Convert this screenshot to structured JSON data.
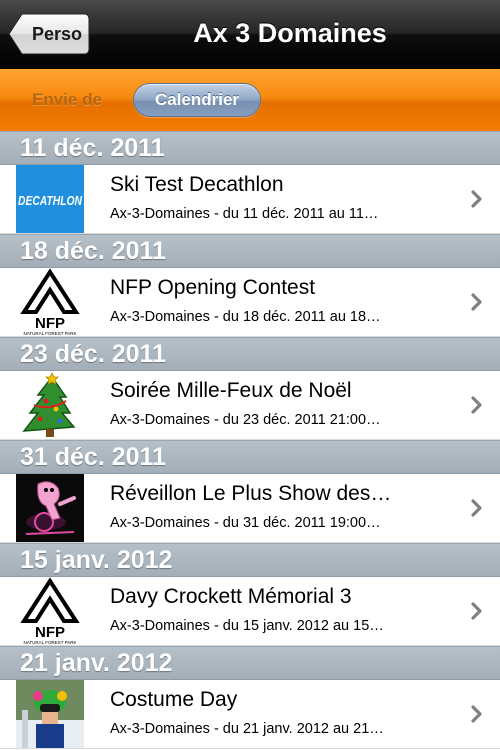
{
  "navbar": {
    "back_label": "Perso",
    "title": "Ax 3 Domaines"
  },
  "segments": {
    "left_label": "Envie de",
    "right_label": "Calendrier"
  },
  "sections": [
    {
      "header": "11 déc. 2011",
      "events": [
        {
          "title": "Ski Test Decathlon",
          "subtitle": "Ax-3-Domaines - du 11 déc. 2011 au 11…",
          "thumb": "decathlon-logo"
        }
      ]
    },
    {
      "header": "18 déc. 2011",
      "events": [
        {
          "title": "NFP Opening Contest",
          "subtitle": "Ax-3-Domaines - du 18 déc. 2011 au 18…",
          "thumb": "nfp-logo"
        }
      ]
    },
    {
      "header": "23 déc. 2011",
      "events": [
        {
          "title": "Soirée Mille-Feux de Noël",
          "subtitle": "Ax-3-Domaines - du 23 déc. 2011 21:00…",
          "thumb": "christmas-tree"
        }
      ]
    },
    {
      "header": "31 déc. 2011",
      "events": [
        {
          "title": "Réveillon Le Plus Show des…",
          "subtitle": "Ax-3-Domaines - du 31 déc. 2011 19:00…",
          "thumb": "pink-panther-dj"
        }
      ]
    },
    {
      "header": "15 janv. 2012",
      "events": [
        {
          "title": "Davy Crockett Mémorial 3",
          "subtitle": "Ax-3-Domaines - du 15 janv. 2012 au 15…",
          "thumb": "nfp-logo"
        }
      ]
    },
    {
      "header": "21 janv. 2012",
      "events": [
        {
          "title": "Costume Day",
          "subtitle": "Ax-3-Domaines - du 21 janv. 2012 au 21…",
          "thumb": "costume-photo"
        }
      ]
    }
  ],
  "thumb_texts": {
    "decathlon": "DECATHLON",
    "nfp": "NFP",
    "nfp_caption": "NATURAL FOREST PARK"
  },
  "colors": {
    "orange_bar": "#f88a10",
    "section_header": "#a9b3bd",
    "segment_selected": "#8ea5c3",
    "decathlon_blue": "#1f8fde"
  }
}
